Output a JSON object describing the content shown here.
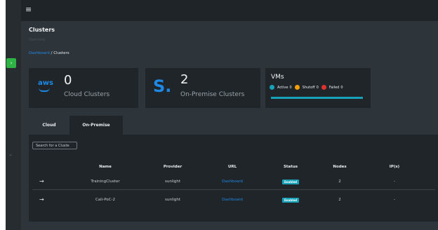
{
  "topbar": {
    "menu_icon": "hamburger-icon"
  },
  "sidebar": {
    "toggle_icon": "chevron-right-icon",
    "collapse_icon": "chevron-down-icon"
  },
  "page": {
    "title": "Clusters",
    "subtitle": "Overview",
    "breadcrumb": {
      "dashboard": "Dashboard",
      "separator": "/",
      "current": "Clusters"
    }
  },
  "cards": {
    "cloud": {
      "logo": "aws",
      "count": "0",
      "label": "Cloud Clusters"
    },
    "onprem": {
      "logo": "S.",
      "count": "2",
      "label": "On-Premise Clusters"
    },
    "vms": {
      "title": "VMs",
      "active_label": "Active",
      "active_count": "0",
      "shutoff_label": "Shutoff",
      "shutoff_count": "0",
      "failed_label": "Failed",
      "failed_count": "0",
      "colors": {
        "active": "#17a2b8",
        "shutoff": "#f59f00",
        "failed": "#e03131"
      }
    }
  },
  "tabs": {
    "cloud": "Cloud",
    "onprem": "On-Premise"
  },
  "search": {
    "placeholder": "Search for a Cluste"
  },
  "table": {
    "headers": {
      "name": "Name",
      "provider": "Provider",
      "url": "URL",
      "status": "Status",
      "nodes": "Nodes",
      "ips": "IP(s)"
    },
    "rows": [
      {
        "name": "TrainingCluster",
        "provider": "sunlight",
        "url": "Dashboard",
        "status": "Enabled",
        "nodes": "2",
        "ips": "-"
      },
      {
        "name": "Cali-PoC-2",
        "provider": "sunlight",
        "url": "Dashboard",
        "status": "Enabled",
        "nodes": "2",
        "ips": "-"
      }
    ]
  },
  "colors": {
    "accent": "#1e88e5",
    "sidebar_active": "#2fb344"
  }
}
